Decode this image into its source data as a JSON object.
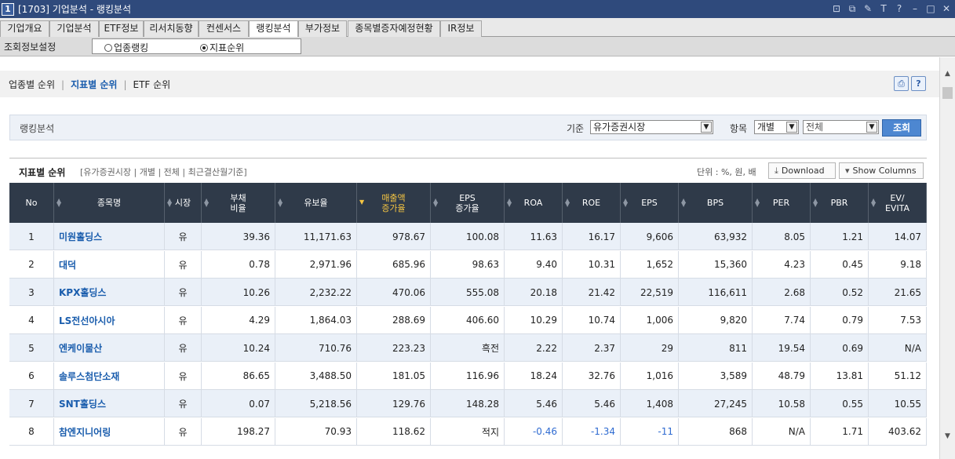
{
  "window": {
    "badge": "1",
    "title": "[1703] 기업분석 - 랭킹분석",
    "controls": [
      "⊡",
      "⧉",
      "✎",
      "T",
      "?",
      "–",
      "□",
      "✕"
    ]
  },
  "tabs": [
    {
      "label": "기업개요"
    },
    {
      "label": "기업분석"
    },
    {
      "label": "ETF정보"
    },
    {
      "label": "리서치동향"
    },
    {
      "label": "컨센서스"
    },
    {
      "label": "랭킹분석",
      "active": true
    },
    {
      "label": "부가정보"
    },
    {
      "label": "종목별증자예정현황"
    },
    {
      "label": "IR정보"
    }
  ],
  "config": {
    "label": "조회정보설정",
    "options": [
      {
        "label": "업종랭킹",
        "selected": false
      },
      {
        "label": "지표순위",
        "selected": true
      }
    ]
  },
  "subnav": {
    "items": [
      "업종별 순위",
      "지표별 순위",
      "ETF 순위"
    ],
    "active_index": 1
  },
  "filter": {
    "panel_label": "랭킹분석",
    "basis_label": "기준",
    "basis_value": "유가증권시장",
    "item_label": "항목",
    "item_value1": "개별",
    "item_value2": "전체",
    "search_label": "조회"
  },
  "section": {
    "title": "지표별 순위",
    "subtitle": "[유가증권시장 | 개별 | 전체 | 최근결산월기준]",
    "unit": "단위 : %, 원, 배",
    "download_label": "Download",
    "columns_label": "Show Columns"
  },
  "table": {
    "columns": [
      "No",
      "종목명",
      "시장",
      "부채\n비율",
      "유보율",
      "매출액\n증가율",
      "EPS\n증가율",
      "ROA",
      "ROE",
      "EPS",
      "BPS",
      "PER",
      "PBR",
      "EV/\nEVITA"
    ],
    "sorted_column": 5,
    "rows": [
      [
        "1",
        "미원홀딩스",
        "유",
        "39.36",
        "11,171.63",
        "978.67",
        "100.08",
        "11.63",
        "16.17",
        "9,606",
        "63,932",
        "8.05",
        "1.21",
        "14.07"
      ],
      [
        "2",
        "대덕",
        "유",
        "0.78",
        "2,971.96",
        "685.96",
        "98.63",
        "9.40",
        "10.31",
        "1,652",
        "15,360",
        "4.23",
        "0.45",
        "9.18"
      ],
      [
        "3",
        "KPX홀딩스",
        "유",
        "10.26",
        "2,232.22",
        "470.06",
        "555.08",
        "20.18",
        "21.42",
        "22,519",
        "116,611",
        "2.68",
        "0.52",
        "21.65"
      ],
      [
        "4",
        "LS전선아시아",
        "유",
        "4.29",
        "1,864.03",
        "288.69",
        "406.60",
        "10.29",
        "10.74",
        "1,006",
        "9,820",
        "7.74",
        "0.79",
        "7.53"
      ],
      [
        "5",
        "엔케이물산",
        "유",
        "10.24",
        "710.76",
        "223.23",
        "흑전",
        "2.22",
        "2.37",
        "29",
        "811",
        "19.54",
        "0.69",
        "N/A"
      ],
      [
        "6",
        "솔루스첨단소재",
        "유",
        "86.65",
        "3,488.50",
        "181.05",
        "116.96",
        "18.24",
        "32.76",
        "1,016",
        "3,589",
        "48.79",
        "13.81",
        "51.12"
      ],
      [
        "7",
        "SNT홀딩스",
        "유",
        "0.07",
        "5,218.56",
        "129.76",
        "148.28",
        "5.46",
        "5.46",
        "1,408",
        "27,245",
        "10.58",
        "0.55",
        "10.55"
      ],
      [
        "8",
        "참엔지니어링",
        "유",
        "198.27",
        "70.93",
        "118.62",
        "적지",
        "-0.46",
        "-1.34",
        "-11",
        "868",
        "N/A",
        "1.71",
        "403.62"
      ]
    ]
  }
}
